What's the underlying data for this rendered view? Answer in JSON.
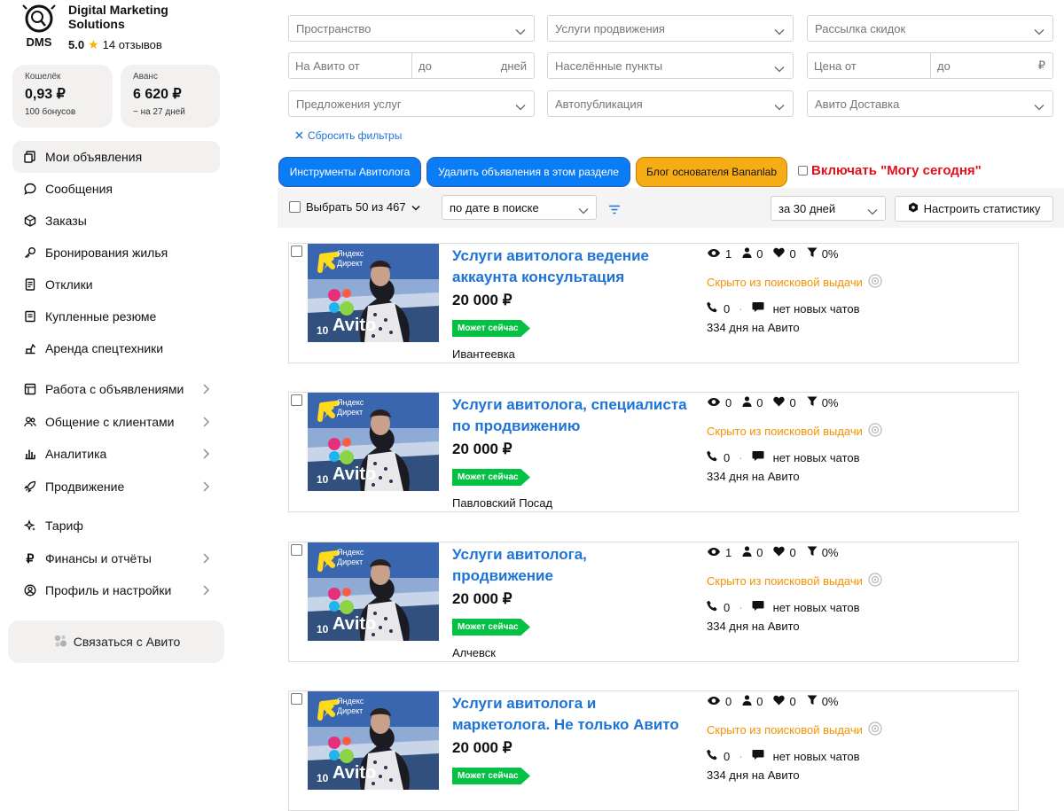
{
  "profile": {
    "logo_text": "DMS",
    "name": "Digital Marketing Solutions",
    "rating": "5.0",
    "reviews": "14 отзывов"
  },
  "balances": [
    {
      "label": "Кошелёк",
      "value": "0,93 ₽",
      "sub": "100 бонусов"
    },
    {
      "label": "Аванс",
      "value": "6 620 ₽",
      "sub": "~ на 27 дней"
    }
  ],
  "nav": [
    {
      "label": "Мои объявления",
      "icon": "copy-icon"
    },
    {
      "label": "Сообщения",
      "icon": "chat-bubble-icon"
    },
    {
      "label": "Заказы",
      "icon": "box-icon"
    },
    {
      "label": "Бронирования жилья",
      "icon": "key-icon"
    },
    {
      "label": "Отклики",
      "icon": "document-icon"
    },
    {
      "label": "Купленные резюме",
      "icon": "resume-icon"
    },
    {
      "label": "Аренда спецтехники",
      "icon": "excavator-icon"
    },
    {
      "label": "Работа с объявлениями",
      "icon": "layout-icon"
    },
    {
      "label": "Общение с клиентами",
      "icon": "users-icon"
    },
    {
      "label": "Аналитика",
      "icon": "bar-chart-icon"
    },
    {
      "label": "Продвижение",
      "icon": "rocket-icon"
    },
    {
      "label": "Тариф",
      "icon": "sparkle-icon"
    },
    {
      "label": "Финансы и отчёты",
      "icon": "ruble-icon"
    },
    {
      "label": "Профиль и настройки",
      "icon": "profile-icon"
    }
  ],
  "contact_label": "Связаться с Авито",
  "filters": {
    "space": "Пространство",
    "promo_services": "Услуги продвижения",
    "discount_mailing": "Рассылка скидок",
    "on_avito_from": "На Авито от",
    "to": "до",
    "days": "дней",
    "localities": "Населённые пункты",
    "price_from": "Цена от",
    "price_to": "до",
    "ruble": "₽",
    "service_offers": "Предложения услуг",
    "autopublish": "Автопубликация",
    "avito_delivery": "Авито Доставка",
    "reset": "Сбросить фильтры"
  },
  "actions": {
    "tools": "Инструменты Авитолога",
    "delete": "Удалить объявления в этом разделе",
    "blog": "Блог основателя Bananlab",
    "can_today": "Включать \"Могу сегодня\""
  },
  "toolbar": {
    "select_all": "Выбрать 50 из 467",
    "sort": "по дате в поиске",
    "period": "за 30 дней",
    "stats_button": "Настроить статистику"
  },
  "thumb": {
    "yandex": "Яндекс",
    "direct": "Директ",
    "avito": "Avito",
    "num": "10"
  },
  "listings": [
    {
      "title": "Услуги авитолога ведение аккаунта консультация",
      "price": "20 000 ₽",
      "badge": "Может сейчас",
      "city": "Ивантеевка",
      "views": "1",
      "contacts": "0",
      "favs": "0",
      "conv": "0%",
      "status": "Скрыто из поисковой выдачи",
      "calls": "0",
      "chats": "нет новых чатов",
      "days": "334 дня на Авито"
    },
    {
      "title": "Услуги авитолога, специалиста по продвижению",
      "price": "20 000 ₽",
      "badge": "Может сейчас",
      "city": "Павловский Посад",
      "views": "0",
      "contacts": "0",
      "favs": "0",
      "conv": "0%",
      "status": "Скрыто из поисковой выдачи",
      "calls": "0",
      "chats": "нет новых чатов",
      "days": "334 дня на Авито"
    },
    {
      "title": "Услуги авитолога, продвижение",
      "price": "20 000 ₽",
      "badge": "Может сейчас",
      "city": "Алчевск",
      "views": "1",
      "contacts": "0",
      "favs": "0",
      "conv": "0%",
      "status": "Скрыто из поисковой выдачи",
      "calls": "0",
      "chats": "нет новых чатов",
      "days": "334 дня на Авито"
    },
    {
      "title": "Услуги авитолога и маркетолога. Не только Авито",
      "price": "20 000 ₽",
      "badge": "Может сейчас",
      "city": "",
      "views": "0",
      "contacts": "0",
      "favs": "0",
      "conv": "0%",
      "status": "Скрыто из поисковой выдачи",
      "calls": "0",
      "chats": "нет новых чатов",
      "days": "334 дня на Авито"
    }
  ]
}
